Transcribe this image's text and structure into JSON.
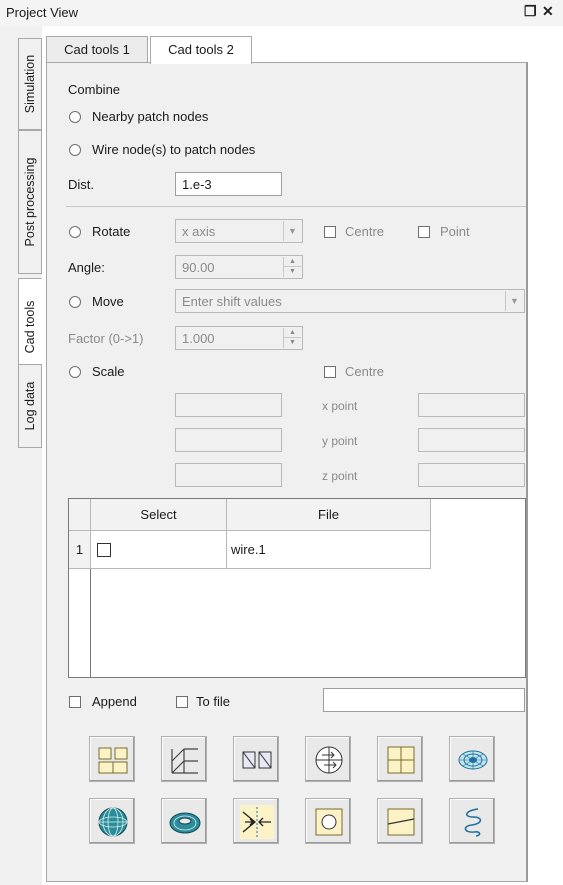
{
  "window": {
    "title": "Project View",
    "float_glyph": "❐",
    "close_glyph": "✕"
  },
  "side_tabs": [
    "Simulation",
    "Post processing",
    "Cad tools",
    "Log data"
  ],
  "top_tabs": [
    "Cad tools 1",
    "Cad tools 2"
  ],
  "combine": {
    "heading": "Combine",
    "nearby_label": "Nearby patch nodes",
    "wire_label": "Wire node(s) to patch nodes",
    "dist_label": "Dist.",
    "dist_value": "1.e-3"
  },
  "rotate": {
    "label": "Rotate",
    "axis_value": "x axis",
    "centre_label": "Centre",
    "point_label": "Point",
    "angle_label": "Angle:",
    "angle_value": "90.00"
  },
  "move": {
    "label": "Move",
    "shift_value": "Enter shift values",
    "factor_label": "Factor (0->1)",
    "factor_value": "1.000"
  },
  "scale": {
    "label": "Scale",
    "centre_label": "Centre",
    "x_point_label": "x point",
    "y_point_label": "y point",
    "z_point_label": "z point"
  },
  "table": {
    "columns": [
      "Select",
      "File"
    ],
    "rows": [
      {
        "num": "1",
        "file": "wire.1"
      }
    ]
  },
  "bottom": {
    "append_label": "Append",
    "tofile_label": "To file"
  },
  "tool_icons": [
    "split-quads-icon",
    "stair-grid-icon",
    "mirror-squares-icon",
    "circle-arrows-icon",
    "quad-split-icon",
    "disc-mesh-icon",
    "sphere-mesh-icon",
    "torus-mesh-icon",
    "merge-arrows-icon",
    "circle-in-square-icon",
    "diagonal-split-icon",
    "helix-icon"
  ],
  "colors": {
    "icon_yellow": "#fbf2c6",
    "icon_blue": "#1f6f9f",
    "icon_teal": "#2b8c9a"
  }
}
